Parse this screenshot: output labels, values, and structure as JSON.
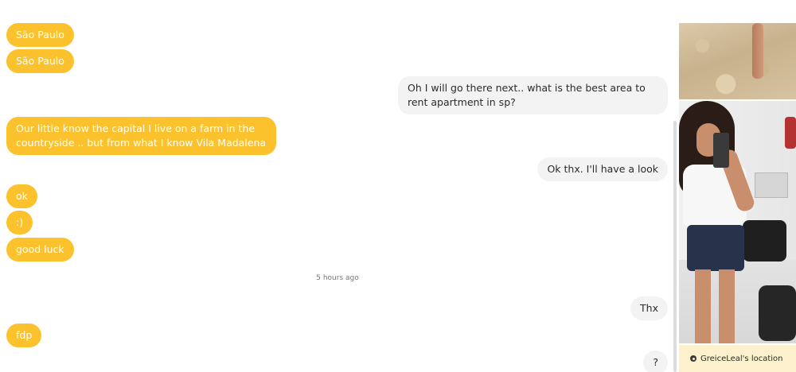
{
  "messages": [
    {
      "dir": "in",
      "text": "São Paulo"
    },
    {
      "dir": "in",
      "text": "São Paulo"
    },
    {
      "dir": "out",
      "text": "Oh I will go there next.. what is the best area to rent apartment in sp?"
    },
    {
      "dir": "in",
      "text": "Our little know the capital I live on a farm in the countryside .. but from what I know Vila Madalena"
    },
    {
      "dir": "out",
      "text": "Ok thx. I'll have a look"
    },
    {
      "dir": "in",
      "text": "ok"
    },
    {
      "dir": "in",
      "text": ":)"
    },
    {
      "dir": "in",
      "text": "good luck"
    },
    {
      "dir": "out",
      "text": "Thx"
    },
    {
      "dir": "in",
      "text": "fdp"
    },
    {
      "dir": "out",
      "text": "?"
    }
  ],
  "timestamp": "5 hours ago",
  "sidebar": {
    "location_label": "GreiceLeal's location",
    "location_icon": "map-pin-icon"
  },
  "colors": {
    "incoming_bubble": "#fcc22e",
    "outgoing_bubble": "#f3f3f3",
    "location_bar": "#fcf0cd"
  }
}
